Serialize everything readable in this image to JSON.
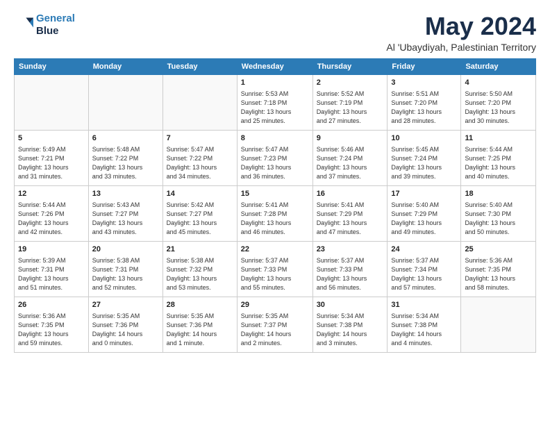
{
  "logo": {
    "line1": "General",
    "line2": "Blue"
  },
  "title": "May 2024",
  "location": "Al 'Ubaydiyah, Palestinian Territory",
  "days_of_week": [
    "Sunday",
    "Monday",
    "Tuesday",
    "Wednesday",
    "Thursday",
    "Friday",
    "Saturday"
  ],
  "weeks": [
    [
      {
        "num": "",
        "info": ""
      },
      {
        "num": "",
        "info": ""
      },
      {
        "num": "",
        "info": ""
      },
      {
        "num": "1",
        "info": "Sunrise: 5:53 AM\nSunset: 7:18 PM\nDaylight: 13 hours\nand 25 minutes."
      },
      {
        "num": "2",
        "info": "Sunrise: 5:52 AM\nSunset: 7:19 PM\nDaylight: 13 hours\nand 27 minutes."
      },
      {
        "num": "3",
        "info": "Sunrise: 5:51 AM\nSunset: 7:20 PM\nDaylight: 13 hours\nand 28 minutes."
      },
      {
        "num": "4",
        "info": "Sunrise: 5:50 AM\nSunset: 7:20 PM\nDaylight: 13 hours\nand 30 minutes."
      }
    ],
    [
      {
        "num": "5",
        "info": "Sunrise: 5:49 AM\nSunset: 7:21 PM\nDaylight: 13 hours\nand 31 minutes."
      },
      {
        "num": "6",
        "info": "Sunrise: 5:48 AM\nSunset: 7:22 PM\nDaylight: 13 hours\nand 33 minutes."
      },
      {
        "num": "7",
        "info": "Sunrise: 5:47 AM\nSunset: 7:22 PM\nDaylight: 13 hours\nand 34 minutes."
      },
      {
        "num": "8",
        "info": "Sunrise: 5:47 AM\nSunset: 7:23 PM\nDaylight: 13 hours\nand 36 minutes."
      },
      {
        "num": "9",
        "info": "Sunrise: 5:46 AM\nSunset: 7:24 PM\nDaylight: 13 hours\nand 37 minutes."
      },
      {
        "num": "10",
        "info": "Sunrise: 5:45 AM\nSunset: 7:24 PM\nDaylight: 13 hours\nand 39 minutes."
      },
      {
        "num": "11",
        "info": "Sunrise: 5:44 AM\nSunset: 7:25 PM\nDaylight: 13 hours\nand 40 minutes."
      }
    ],
    [
      {
        "num": "12",
        "info": "Sunrise: 5:44 AM\nSunset: 7:26 PM\nDaylight: 13 hours\nand 42 minutes."
      },
      {
        "num": "13",
        "info": "Sunrise: 5:43 AM\nSunset: 7:27 PM\nDaylight: 13 hours\nand 43 minutes."
      },
      {
        "num": "14",
        "info": "Sunrise: 5:42 AM\nSunset: 7:27 PM\nDaylight: 13 hours\nand 45 minutes."
      },
      {
        "num": "15",
        "info": "Sunrise: 5:41 AM\nSunset: 7:28 PM\nDaylight: 13 hours\nand 46 minutes."
      },
      {
        "num": "16",
        "info": "Sunrise: 5:41 AM\nSunset: 7:29 PM\nDaylight: 13 hours\nand 47 minutes."
      },
      {
        "num": "17",
        "info": "Sunrise: 5:40 AM\nSunset: 7:29 PM\nDaylight: 13 hours\nand 49 minutes."
      },
      {
        "num": "18",
        "info": "Sunrise: 5:40 AM\nSunset: 7:30 PM\nDaylight: 13 hours\nand 50 minutes."
      }
    ],
    [
      {
        "num": "19",
        "info": "Sunrise: 5:39 AM\nSunset: 7:31 PM\nDaylight: 13 hours\nand 51 minutes."
      },
      {
        "num": "20",
        "info": "Sunrise: 5:38 AM\nSunset: 7:31 PM\nDaylight: 13 hours\nand 52 minutes."
      },
      {
        "num": "21",
        "info": "Sunrise: 5:38 AM\nSunset: 7:32 PM\nDaylight: 13 hours\nand 53 minutes."
      },
      {
        "num": "22",
        "info": "Sunrise: 5:37 AM\nSunset: 7:33 PM\nDaylight: 13 hours\nand 55 minutes."
      },
      {
        "num": "23",
        "info": "Sunrise: 5:37 AM\nSunset: 7:33 PM\nDaylight: 13 hours\nand 56 minutes."
      },
      {
        "num": "24",
        "info": "Sunrise: 5:37 AM\nSunset: 7:34 PM\nDaylight: 13 hours\nand 57 minutes."
      },
      {
        "num": "25",
        "info": "Sunrise: 5:36 AM\nSunset: 7:35 PM\nDaylight: 13 hours\nand 58 minutes."
      }
    ],
    [
      {
        "num": "26",
        "info": "Sunrise: 5:36 AM\nSunset: 7:35 PM\nDaylight: 13 hours\nand 59 minutes."
      },
      {
        "num": "27",
        "info": "Sunrise: 5:35 AM\nSunset: 7:36 PM\nDaylight: 14 hours\nand 0 minutes."
      },
      {
        "num": "28",
        "info": "Sunrise: 5:35 AM\nSunset: 7:36 PM\nDaylight: 14 hours\nand 1 minute."
      },
      {
        "num": "29",
        "info": "Sunrise: 5:35 AM\nSunset: 7:37 PM\nDaylight: 14 hours\nand 2 minutes."
      },
      {
        "num": "30",
        "info": "Sunrise: 5:34 AM\nSunset: 7:38 PM\nDaylight: 14 hours\nand 3 minutes."
      },
      {
        "num": "31",
        "info": "Sunrise: 5:34 AM\nSunset: 7:38 PM\nDaylight: 14 hours\nand 4 minutes."
      },
      {
        "num": "",
        "info": ""
      }
    ]
  ]
}
